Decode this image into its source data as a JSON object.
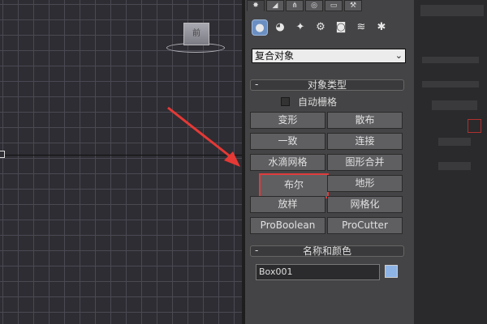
{
  "viewport": {
    "viewcube_label": "前"
  },
  "command_panel": {
    "top_tabs": [
      {
        "icon": "create-icon",
        "glyph": "✸"
      },
      {
        "icon": "modify-icon",
        "glyph": "◢"
      },
      {
        "icon": "hierarchy-icon",
        "glyph": "⋔"
      },
      {
        "icon": "motion-icon",
        "glyph": "◎"
      },
      {
        "icon": "display-icon",
        "glyph": "▭"
      },
      {
        "icon": "utilities-icon",
        "glyph": "⚒"
      }
    ],
    "sub_icons": [
      {
        "icon": "geometry-icon",
        "glyph": "●",
        "active": true
      },
      {
        "icon": "shapes-icon",
        "glyph": "◕"
      },
      {
        "icon": "lights-icon",
        "glyph": "✦"
      },
      {
        "icon": "cameras-icon",
        "glyph": "⚙"
      },
      {
        "icon": "helpers-icon",
        "glyph": "◙"
      },
      {
        "icon": "spacewarps-icon",
        "glyph": "≋"
      },
      {
        "icon": "systems-icon",
        "glyph": "✱"
      }
    ],
    "category_value": "复合对象",
    "object_type": {
      "header": "对象类型",
      "collapse_symbol": "-",
      "autogrid_label": "自动栅格",
      "buttons": [
        "变形",
        "散布",
        "一致",
        "连接",
        "水滴网格",
        "图形合并",
        "布尔",
        "地形",
        "放样",
        "网格化",
        "ProBoolean",
        "ProCutter"
      ]
    },
    "name_color": {
      "header": "名称和颜色",
      "collapse_symbol": "-",
      "name_value": "Box001"
    }
  },
  "colors": {
    "highlight": "#e03c3c",
    "arrow": "#e53935",
    "swatch": "#8eb4e6"
  }
}
